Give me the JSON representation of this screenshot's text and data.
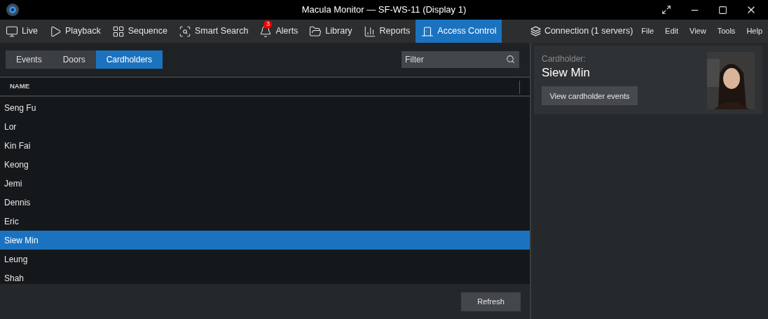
{
  "window": {
    "title": "Macula Monitor — SF-WS-11 (Display 1)"
  },
  "nav": [
    {
      "kind": "live",
      "label": "Live",
      "selected": false
    },
    {
      "kind": "playback",
      "label": "Playback",
      "selected": false
    },
    {
      "kind": "sequence",
      "label": "Sequence",
      "selected": false
    },
    {
      "kind": "search",
      "label": "Smart Search",
      "selected": false
    },
    {
      "kind": "alerts",
      "label": "Alerts",
      "selected": false,
      "badge": "3"
    },
    {
      "kind": "library",
      "label": "Library",
      "selected": false
    },
    {
      "kind": "reports",
      "label": "Reports",
      "selected": false
    },
    {
      "kind": "access",
      "label": "Access Control",
      "selected": true
    }
  ],
  "connection": "Connection (1 servers)",
  "menu": [
    "File",
    "Edit",
    "View",
    "Tools",
    "Help"
  ],
  "tabs": [
    {
      "label": "Events",
      "selected": false
    },
    {
      "label": "Doors",
      "selected": false
    },
    {
      "label": "Cardholders",
      "selected": true
    }
  ],
  "filter": {
    "placeholder": "Filter"
  },
  "table": {
    "columns": [
      "NAME"
    ],
    "rows": [
      {
        "name": "Seng Fu",
        "selected": false
      },
      {
        "name": "Lor",
        "selected": false
      },
      {
        "name": "Kin Fai",
        "selected": false
      },
      {
        "name": "Keong",
        "selected": false
      },
      {
        "name": "Jemi",
        "selected": false
      },
      {
        "name": "Dennis",
        "selected": false
      },
      {
        "name": "Eric",
        "selected": false
      },
      {
        "name": "Siew Min",
        "selected": true
      },
      {
        "name": "Leung",
        "selected": false
      },
      {
        "name": "Shah",
        "selected": false
      }
    ]
  },
  "refresh_button": "Refresh",
  "details": {
    "label": "Cardholder:",
    "name": "Siew Min",
    "button": "View cardholder events"
  }
}
